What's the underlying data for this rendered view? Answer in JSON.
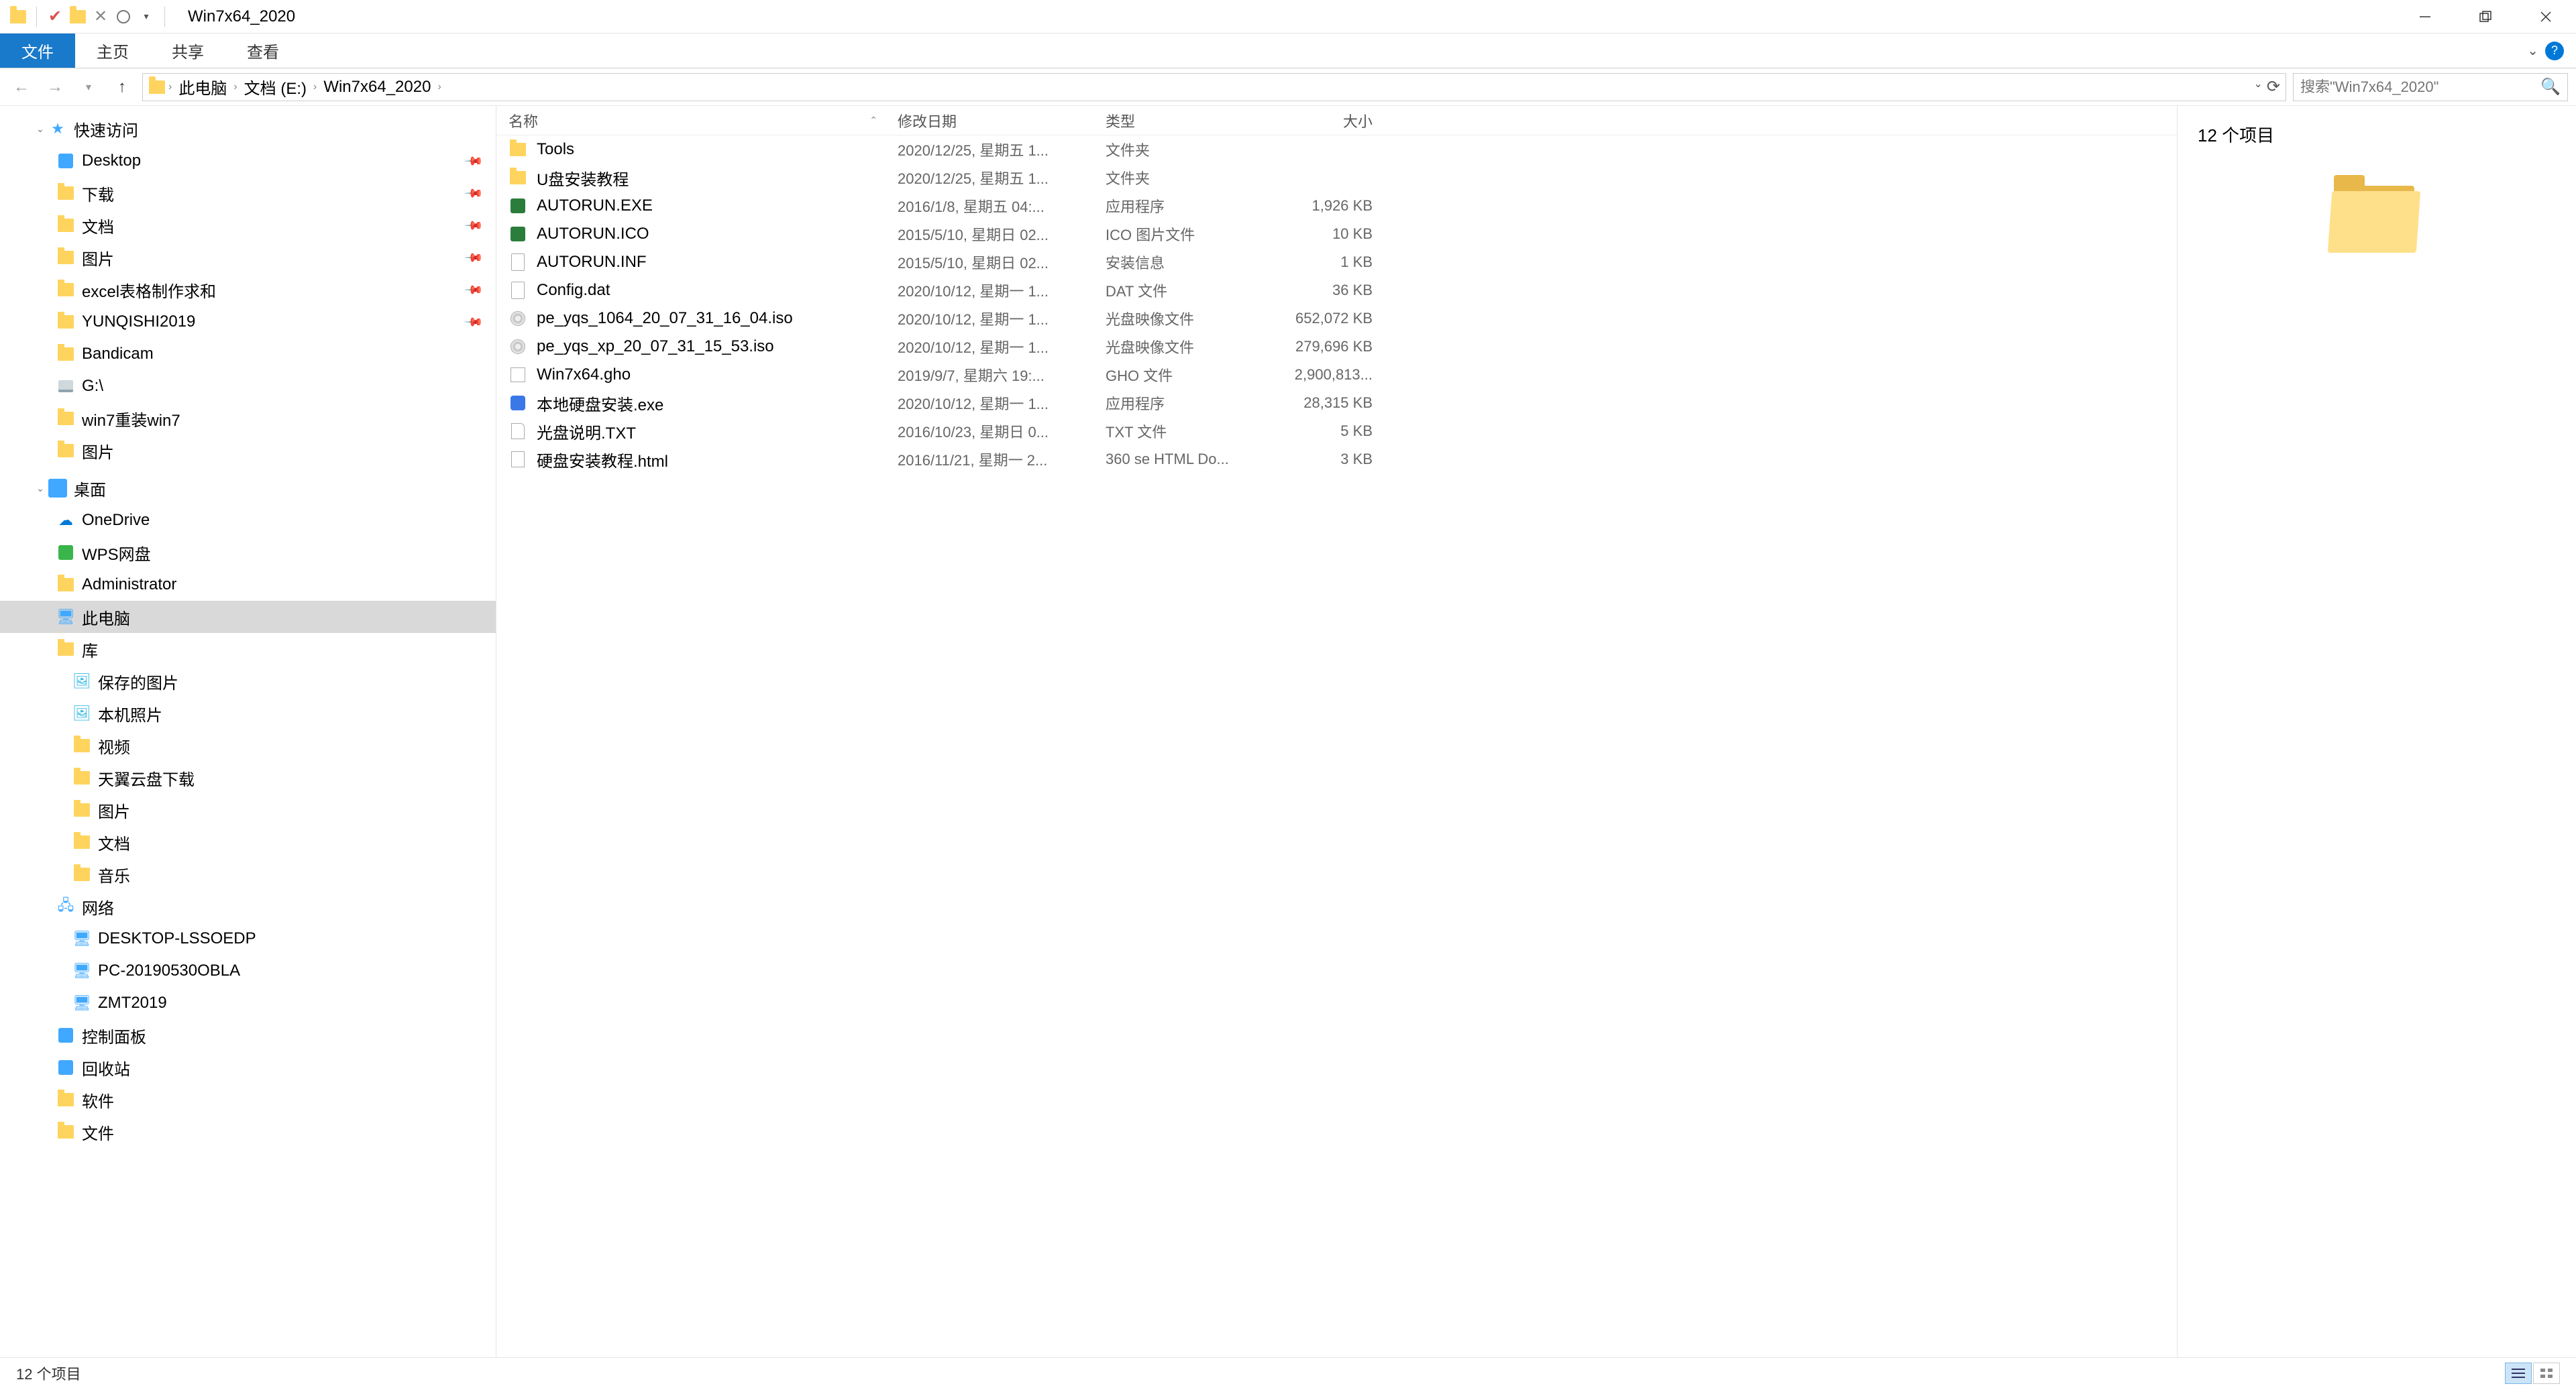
{
  "title": "Win7x64_2020",
  "ribbon": {
    "file": "文件",
    "home": "主页",
    "share": "共享",
    "view": "查看"
  },
  "address": {
    "crumbs": [
      "此电脑",
      "文档 (E:)",
      "Win7x64_2020"
    ]
  },
  "search": {
    "placeholder": "搜索\"Win7x64_2020\""
  },
  "nav": {
    "quick_access": "快速访问",
    "quick_items": [
      {
        "label": "Desktop",
        "icon": "blue",
        "pinned": true
      },
      {
        "label": "下载",
        "icon": "folder",
        "pinned": true
      },
      {
        "label": "文档",
        "icon": "folder",
        "pinned": true
      },
      {
        "label": "图片",
        "icon": "folder",
        "pinned": true
      },
      {
        "label": "excel表格制作求和",
        "icon": "folder",
        "pinned": true
      },
      {
        "label": "YUNQISHI2019",
        "icon": "folder",
        "pinned": true
      },
      {
        "label": "Bandicam",
        "icon": "folder",
        "pinned": false
      },
      {
        "label": "G:\\",
        "icon": "disk",
        "pinned": false
      },
      {
        "label": "win7重装win7",
        "icon": "folder",
        "pinned": false
      },
      {
        "label": "图片",
        "icon": "folder",
        "pinned": false
      }
    ],
    "desktop": "桌面",
    "desktop_items": [
      {
        "label": "OneDrive",
        "icon": "cloud",
        "indent": 1
      },
      {
        "label": "WPS网盘",
        "icon": "green",
        "indent": 1
      },
      {
        "label": "Administrator",
        "icon": "folder",
        "indent": 1
      },
      {
        "label": "此电脑",
        "icon": "pc",
        "indent": 1,
        "selected": true
      },
      {
        "label": "库",
        "icon": "folder",
        "indent": 1
      },
      {
        "label": "保存的图片",
        "icon": "pic",
        "indent": 2
      },
      {
        "label": "本机照片",
        "icon": "pic",
        "indent": 2
      },
      {
        "label": "视频",
        "icon": "folder",
        "indent": 2
      },
      {
        "label": "天翼云盘下载",
        "icon": "folder",
        "indent": 2
      },
      {
        "label": "图片",
        "icon": "folder",
        "indent": 2
      },
      {
        "label": "文档",
        "icon": "folder",
        "indent": 2
      },
      {
        "label": "音乐",
        "icon": "folder",
        "indent": 2
      },
      {
        "label": "网络",
        "icon": "net",
        "indent": 1
      },
      {
        "label": "DESKTOP-LSSOEDP",
        "icon": "pc",
        "indent": 2
      },
      {
        "label": "PC-20190530OBLA",
        "icon": "pc",
        "indent": 2
      },
      {
        "label": "ZMT2019",
        "icon": "pc",
        "indent": 2
      },
      {
        "label": "控制面板",
        "icon": "blue",
        "indent": 1
      },
      {
        "label": "回收站",
        "icon": "blue",
        "indent": 1
      },
      {
        "label": "软件",
        "icon": "folder",
        "indent": 1
      },
      {
        "label": "文件",
        "icon": "folder",
        "indent": 1
      }
    ]
  },
  "columns": {
    "name": "名称",
    "date": "修改日期",
    "type": "类型",
    "size": "大小"
  },
  "files": [
    {
      "name": "Tools",
      "date": "2020/12/25, 星期五 1...",
      "type": "文件夹",
      "size": "",
      "ico": "folder"
    },
    {
      "name": "U盘安装教程",
      "date": "2020/12/25, 星期五 1...",
      "type": "文件夹",
      "size": "",
      "ico": "folder"
    },
    {
      "name": "AUTORUN.EXE",
      "date": "2016/1/8, 星期五 04:...",
      "type": "应用程序",
      "size": "1,926 KB",
      "ico": "exe"
    },
    {
      "name": "AUTORUN.ICO",
      "date": "2015/5/10, 星期日 02...",
      "type": "ICO 图片文件",
      "size": "10 KB",
      "ico": "icoi"
    },
    {
      "name": "AUTORUN.INF",
      "date": "2015/5/10, 星期日 02...",
      "type": "安装信息",
      "size": "1 KB",
      "ico": "doc"
    },
    {
      "name": "Config.dat",
      "date": "2020/10/12, 星期一 1...",
      "type": "DAT 文件",
      "size": "36 KB",
      "ico": "doc"
    },
    {
      "name": "pe_yqs_1064_20_07_31_16_04.iso",
      "date": "2020/10/12, 星期一 1...",
      "type": "光盘映像文件",
      "size": "652,072 KB",
      "ico": "iso"
    },
    {
      "name": "pe_yqs_xp_20_07_31_15_53.iso",
      "date": "2020/10/12, 星期一 1...",
      "type": "光盘映像文件",
      "size": "279,696 KB",
      "ico": "iso"
    },
    {
      "name": "Win7x64.gho",
      "date": "2019/9/7, 星期六 19:...",
      "type": "GHO 文件",
      "size": "2,900,813...",
      "ico": "gho"
    },
    {
      "name": "本地硬盘安装.exe",
      "date": "2020/10/12, 星期一 1...",
      "type": "应用程序",
      "size": "28,315 KB",
      "ico": "inst"
    },
    {
      "name": "光盘说明.TXT",
      "date": "2016/10/23, 星期日 0...",
      "type": "TXT 文件",
      "size": "5 KB",
      "ico": "txt"
    },
    {
      "name": "硬盘安装教程.html",
      "date": "2016/11/21, 星期一 2...",
      "type": "360 se HTML Do...",
      "size": "3 KB",
      "ico": "html"
    }
  ],
  "preview": {
    "header": "12 个项目"
  },
  "status": {
    "text": "12 个项目"
  }
}
